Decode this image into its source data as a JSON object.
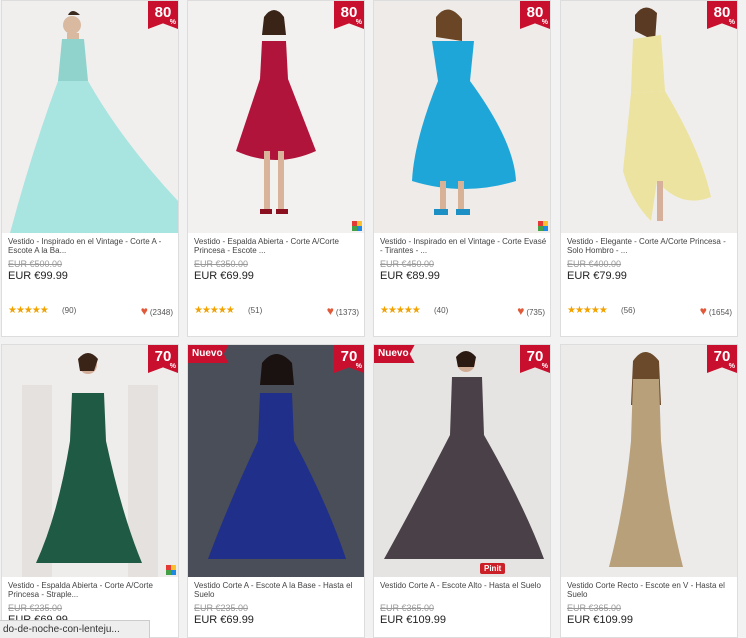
{
  "colors": {
    "accent": "#c8102e",
    "star": "#f3a200",
    "heart": "#e05a3a"
  },
  "products": [
    {
      "title": "Vestido - Inspirado en el Vintage - Corte A - Escote A la Ba...",
      "old_price": "EUR €500.00",
      "price": "EUR €99.99",
      "discount": "80",
      "reviews": "(90)",
      "likes": "(2348)",
      "nuevo": "",
      "dress_color": "#a8e4e0"
    },
    {
      "title": "Vestido - Espalda Abierta - Corte A/Corte Princesa - Escote ...",
      "old_price": "EUR €350.00",
      "price": "EUR €69.99",
      "discount": "80",
      "reviews": "(51)",
      "likes": "(1373)",
      "nuevo": "",
      "dress_color": "#b0143a"
    },
    {
      "title": "Vestido - Inspirado en el Vintage - Corte Evasé - Tirantes - ...",
      "old_price": "EUR €450.00",
      "price": "EUR €89.99",
      "discount": "80",
      "reviews": "(40)",
      "likes": "(735)",
      "nuevo": "",
      "dress_color": "#1fa6d8"
    },
    {
      "title": "Vestido - Elegante - Corte A/Corte Princesa - Solo Hombro - ...",
      "old_price": "EUR €400.00",
      "price": "EUR €79.99",
      "discount": "80",
      "reviews": "(56)",
      "likes": "(1654)",
      "nuevo": "",
      "dress_color": "#ece3a0"
    },
    {
      "title": "Vestido - Espalda Abierta - Corte A/Corte Princesa - Straple...",
      "old_price": "EUR €235.00",
      "price": "EUR €69.99",
      "discount": "70",
      "reviews": "",
      "likes": "",
      "nuevo": "",
      "dress_color": "#1f5a45"
    },
    {
      "title": "Vestido Corte A - Escote A la Base - Hasta el Suelo",
      "old_price": "EUR €235.00",
      "price": "EUR €69.99",
      "discount": "70",
      "reviews": "",
      "likes": "",
      "nuevo": "Nuevo",
      "dress_color": "#1f2f8a"
    },
    {
      "title": "Vestido Corte A - Escote Alto - Hasta el Suelo",
      "old_price": "EUR €365.00",
      "price": "EUR €109.99",
      "discount": "70",
      "reviews": "",
      "likes": "",
      "nuevo": "Nuevo",
      "dress_color": "#4a4048"
    },
    {
      "title": "Vestido Corte Recto - Escote en V - Hasta el Suelo",
      "old_price": "EUR €365.00",
      "price": "EUR €109.99",
      "discount": "70",
      "reviews": "",
      "likes": "",
      "nuevo": "",
      "dress_color": "#b8a07a"
    }
  ],
  "pinit_label": "Pinit",
  "stars_glyph": "★★★★★",
  "heart_glyph": "♥",
  "percent_sign": "%",
  "status_url": "do-de-noche-con-lenteju..."
}
